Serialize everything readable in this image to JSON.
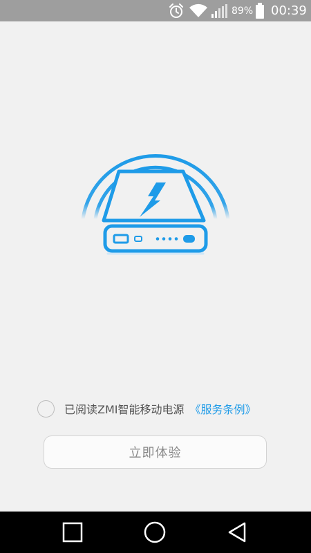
{
  "status_bar": {
    "battery_percent": "89%",
    "time": "00:39",
    "icons": [
      "alarm-icon",
      "wifi-icon",
      "signal-icon",
      "battery-icon"
    ]
  },
  "hero": {
    "icon": "power-bank-wireless-icon",
    "accent_color": "#1e9be8"
  },
  "agreement": {
    "text": "已阅读ZMI智能移动电源",
    "link_text": "《服务条例》",
    "checked": false
  },
  "start_button": {
    "label": "立即体验"
  },
  "nav_bar": {
    "buttons": [
      "recent-apps",
      "home",
      "back"
    ]
  }
}
